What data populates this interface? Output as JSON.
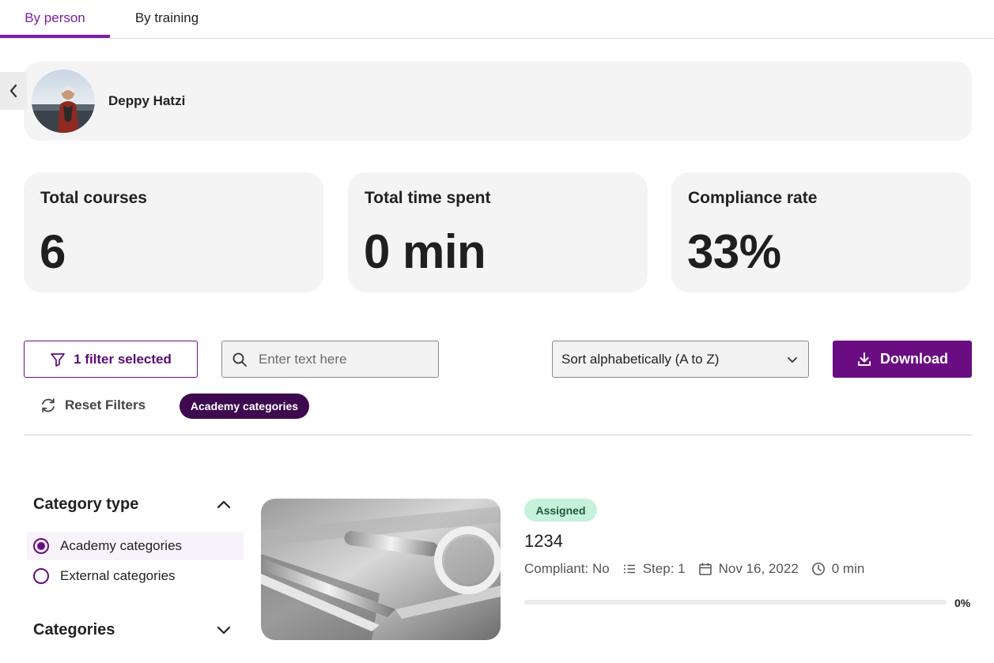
{
  "tabs": [
    {
      "label": "By person",
      "active": true
    },
    {
      "label": "By training",
      "active": false
    }
  ],
  "person": {
    "name": "Deppy Hatzi"
  },
  "stats": {
    "total_courses": {
      "label": "Total courses",
      "value": "6"
    },
    "total_time": {
      "label": "Total time spent",
      "value": "0 min"
    },
    "compliance": {
      "label": "Compliance rate",
      "value": "33%"
    }
  },
  "toolbar": {
    "filter_label": "1 filter selected",
    "search_placeholder": "Enter text here",
    "sort_selected": "Sort alphabetically (A to Z)",
    "download_label": "Download",
    "reset_label": "Reset Filters",
    "active_chip": "Academy categories"
  },
  "sidebar": {
    "category_type": {
      "title": "Category type",
      "expanded": true,
      "options": [
        {
          "label": "Academy categories",
          "selected": true
        },
        {
          "label": "External categories",
          "selected": false
        }
      ]
    },
    "categories": {
      "title": "Categories",
      "expanded": false
    }
  },
  "course": {
    "status": "Assigned",
    "title": "1234",
    "compliant": "Compliant: No",
    "step": "Step: 1",
    "date": "Nov 16, 2022",
    "duration": "0 min",
    "progress": 0,
    "progress_label": "0%"
  },
  "colors": {
    "accent": "#6a0d83",
    "chip_bg": "#3d0a4f",
    "badge_bg": "#c6f1da",
    "card_bg": "#f4f4f4"
  },
  "icons": [
    "chevron-left-icon",
    "filter-icon",
    "search-icon",
    "chevron-down-icon",
    "download-icon",
    "refresh-icon",
    "chevron-up-icon",
    "list-icon",
    "calendar-icon",
    "clock-icon"
  ]
}
